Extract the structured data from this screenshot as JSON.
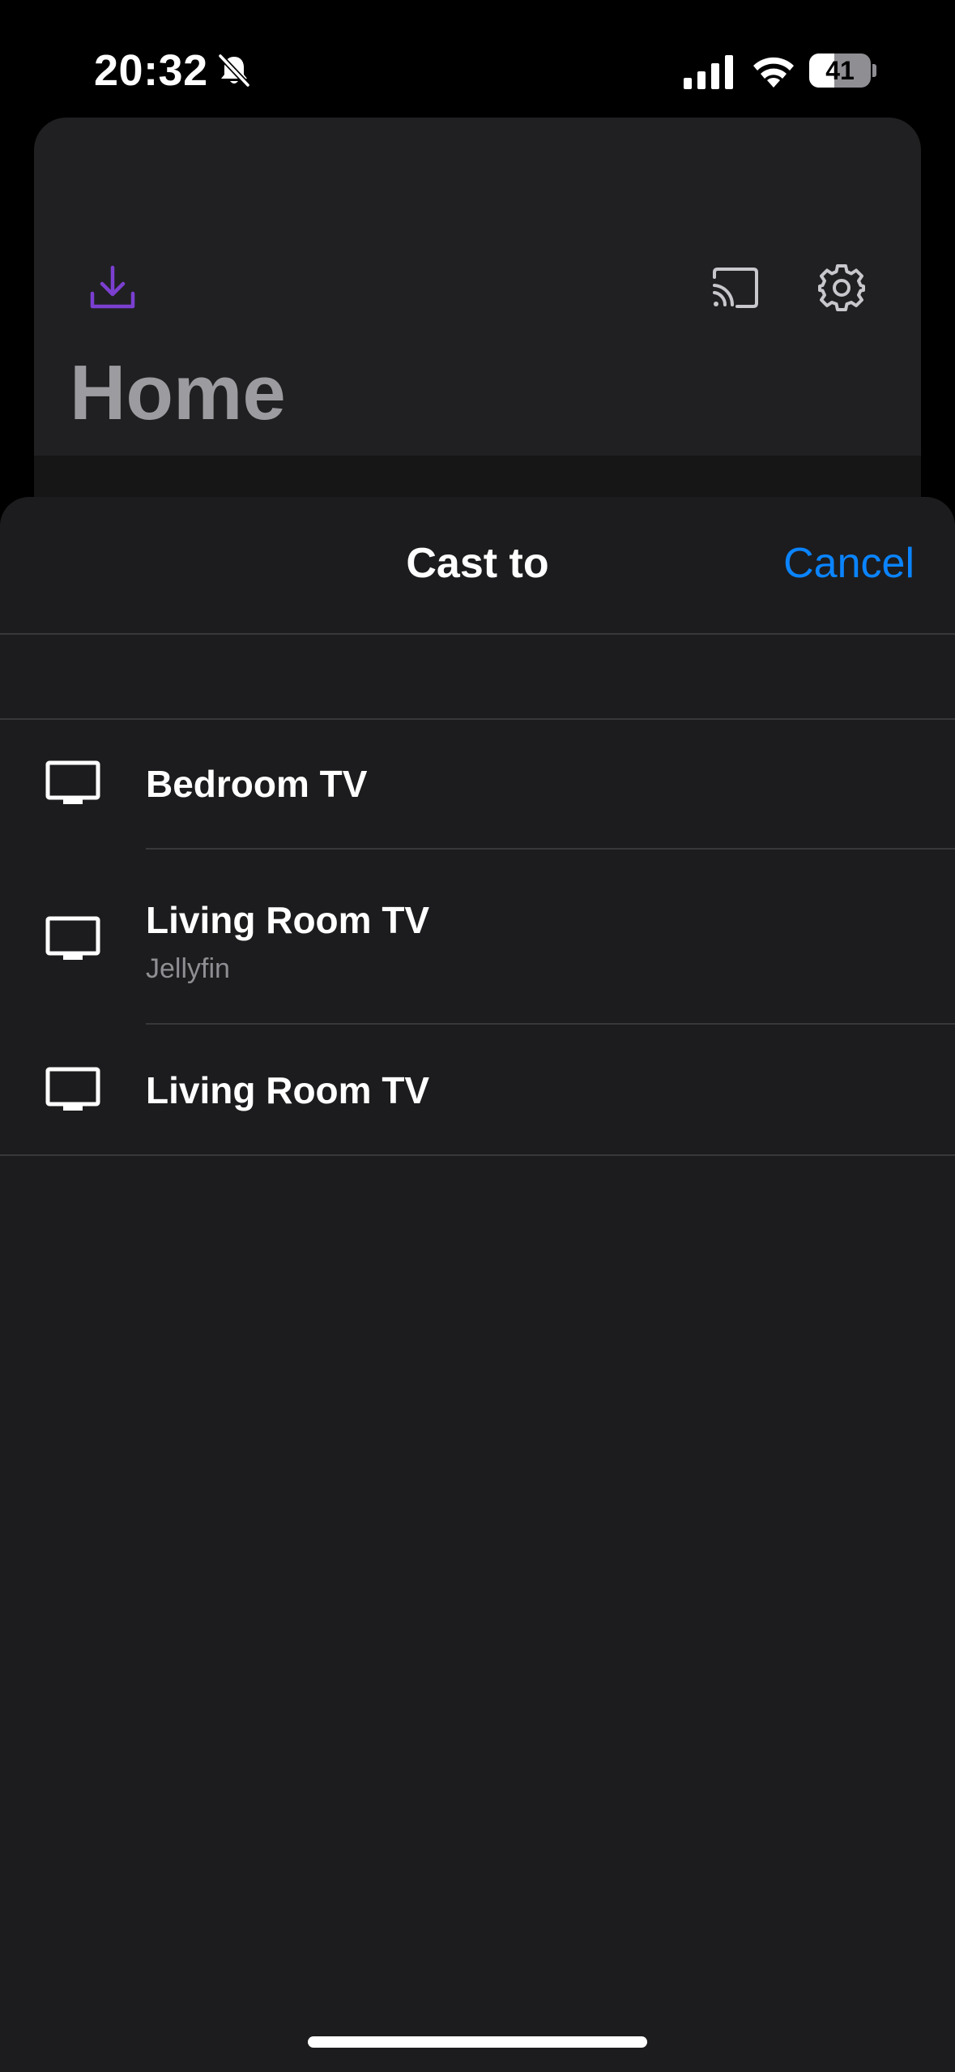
{
  "status_bar": {
    "time": "20:32",
    "battery": "41",
    "icons": [
      "bell-slash-icon",
      "cellular-signal-icon",
      "wifi-icon",
      "battery-icon"
    ]
  },
  "background_app": {
    "title": "Home",
    "icons": [
      "download-icon",
      "cast-icon",
      "gear-icon"
    ],
    "accent_color": "#7b3fd0"
  },
  "sheet": {
    "title": "Cast to",
    "cancel_label": "Cancel",
    "cancel_color": "#0a84ff",
    "devices": [
      {
        "name": "Bedroom TV",
        "subtitle": "",
        "icon": "tv-icon"
      },
      {
        "name": "Living Room TV",
        "subtitle": "Jellyfin",
        "icon": "tv-icon"
      },
      {
        "name": "Living Room TV",
        "subtitle": "",
        "icon": "tv-icon"
      }
    ]
  }
}
